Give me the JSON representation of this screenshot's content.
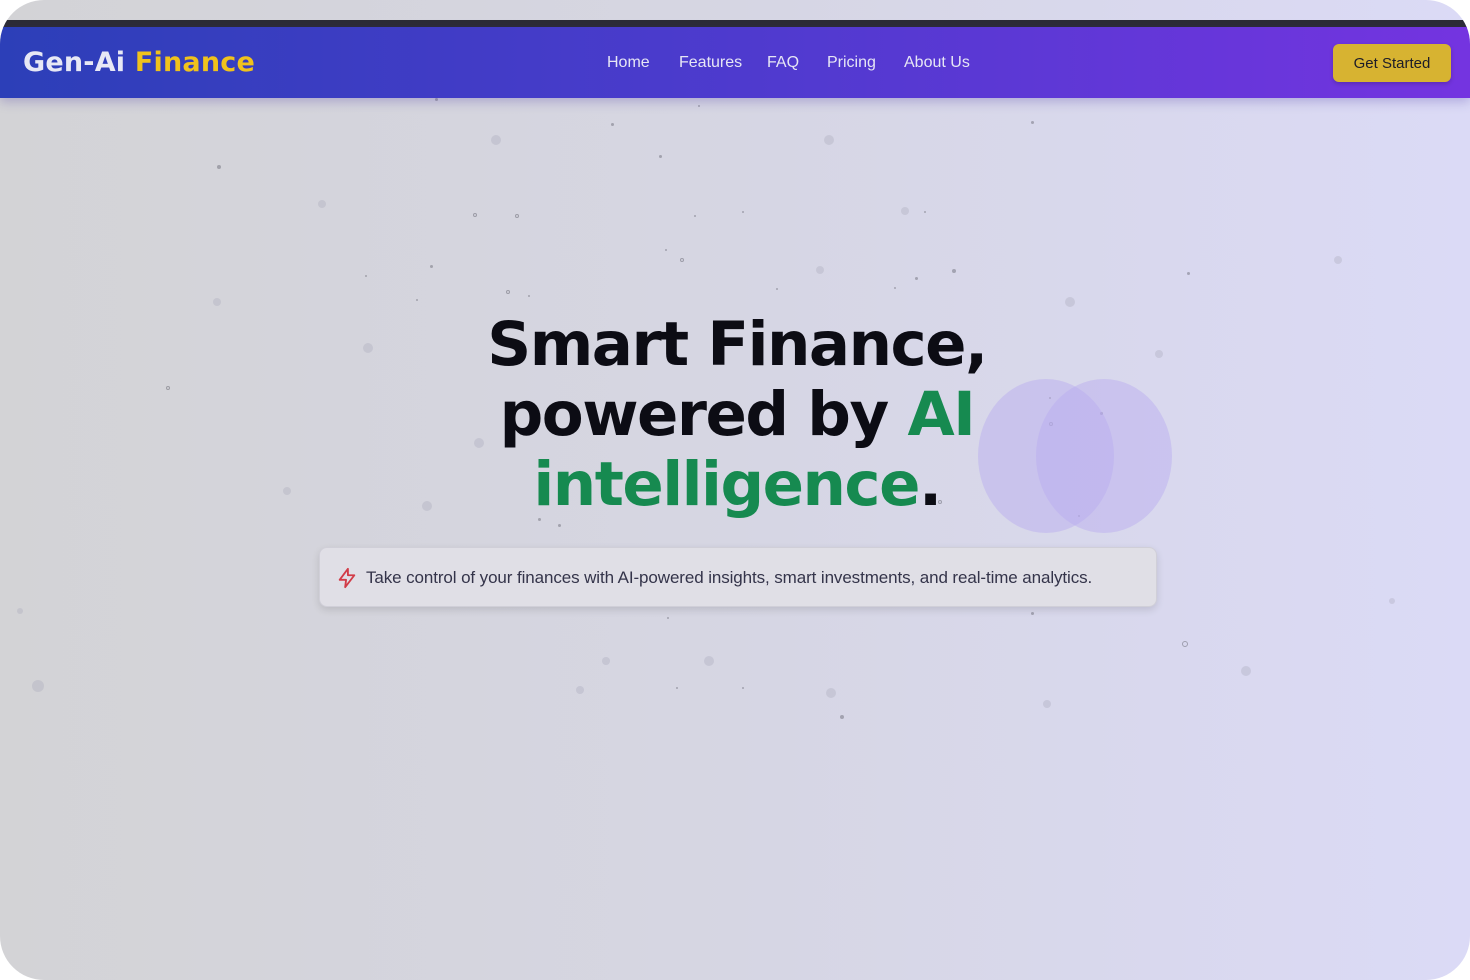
{
  "brand": {
    "part1": "Gen-Ai",
    "part2": "Finance"
  },
  "nav": {
    "items": [
      {
        "label": "Home"
      },
      {
        "label": "Features"
      },
      {
        "label": "FAQ"
      },
      {
        "label": "Pricing"
      },
      {
        "label": "About Us"
      }
    ],
    "cta_label": "Get Started"
  },
  "hero": {
    "line1": "Smart Finance,",
    "line2_prefix": "powered by ",
    "line2_accent": "AI",
    "line3_accent": "intelligence",
    "line3_suffix": "."
  },
  "subtitle": {
    "icon": "lightning-icon",
    "text": "Take control of your finances with AI-powered insights, smart investments, and real-time analytics."
  },
  "colors": {
    "nav_gradient_start": "#2c3fb8",
    "nav_gradient_end": "#7434e0",
    "brand_accent": "#f0c21c",
    "cta_background": "#d7b331",
    "hero_accent": "#168a50",
    "icon_accent": "#d23c48"
  }
}
